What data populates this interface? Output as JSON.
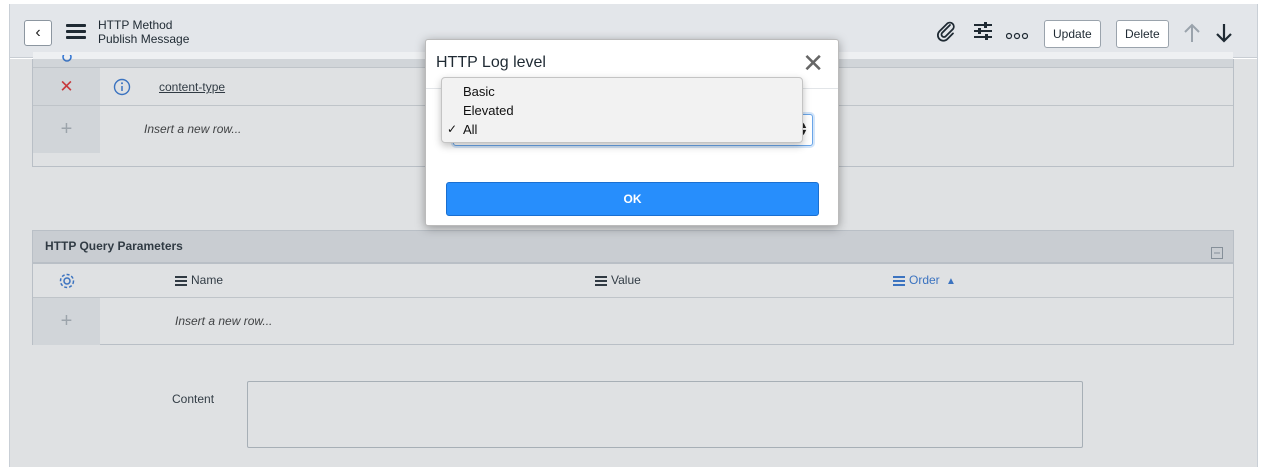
{
  "header": {
    "title_line1": "HTTP Method",
    "title_line2": "Publish Message",
    "update_label": "Update",
    "delete_label": "Delete"
  },
  "headers_table": {
    "rows": [
      {
        "name": "content-type"
      }
    ],
    "insert_row_label": "Insert a new row..."
  },
  "query_params": {
    "title": "HTTP Query Parameters",
    "columns": [
      {
        "label": "Name"
      },
      {
        "label": "Value"
      },
      {
        "label": "Order"
      }
    ],
    "sort_indicator": "▲",
    "insert_row_label": "Insert a new row..."
  },
  "form": {
    "content_label": "Content"
  },
  "modal": {
    "title": "HTTP Log level",
    "close_glyph": "✕",
    "options": [
      "Basic",
      "Elevated",
      "All"
    ],
    "selected": "All",
    "ok_label": "OK"
  },
  "colors": {
    "accent_blue": "#278efc",
    "header_bg": "#e3e6ea",
    "delete_red": "#e0282a",
    "order_blue": "#2d72d2"
  },
  "icons": {
    "back": "chevron-left-icon",
    "menu": "hamburger-icon",
    "attach": "paperclip-icon",
    "settings": "sliders-icon",
    "more": "ellipsis-icon",
    "prev": "arrow-up-icon",
    "next": "arrow-down-icon"
  }
}
